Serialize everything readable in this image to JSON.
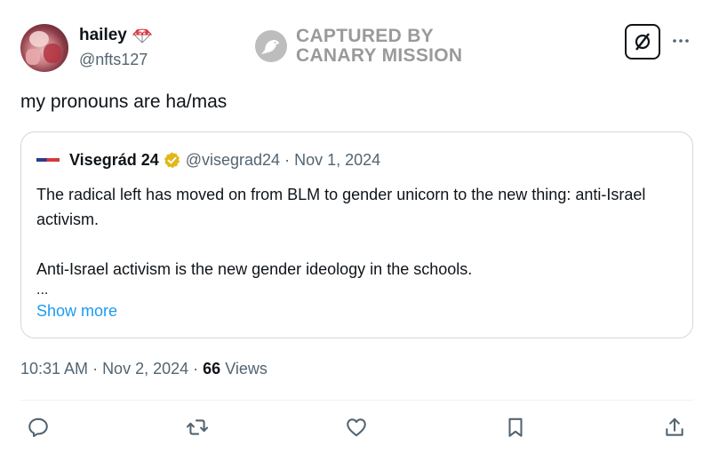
{
  "author": {
    "display_name": "hailey",
    "emoji_icon": "parachute-icon",
    "handle": "@nfts127"
  },
  "watermark": {
    "line1": "CAPTURED BY",
    "line2": "CANARY MISSION",
    "icon": "canary-bird-icon"
  },
  "header_controls": {
    "grok_icon": "grok-icon",
    "more_label": "···"
  },
  "tweet": {
    "text": "my pronouns are ha/mas"
  },
  "quote": {
    "author_name": "Visegrád 24",
    "handle": "@visegrad24",
    "separator": "·",
    "date": "Nov 1, 2024",
    "body_line1": "The radical left has moved on from BLM to gender unicorn to the new thing: anti-Israel activism.",
    "body_line2": "Anti-Israel activism is the new gender ideology in the schools.",
    "ellipsis": "...",
    "show_more": "Show more"
  },
  "meta": {
    "time": "10:31 AM",
    "separator": "·",
    "date": "Nov 2, 2024",
    "views_count": "66",
    "views_label": "Views"
  },
  "actions": [
    {
      "name": "reply-icon"
    },
    {
      "name": "retweet-icon"
    },
    {
      "name": "like-icon"
    },
    {
      "name": "bookmark-icon"
    },
    {
      "name": "share-icon"
    }
  ],
  "colors": {
    "accent": "#1d9bf0",
    "secondary_text": "#536471",
    "border": "#cfd9de",
    "watermark": "#9a9a9a",
    "verified_gold": "#e2b719"
  }
}
